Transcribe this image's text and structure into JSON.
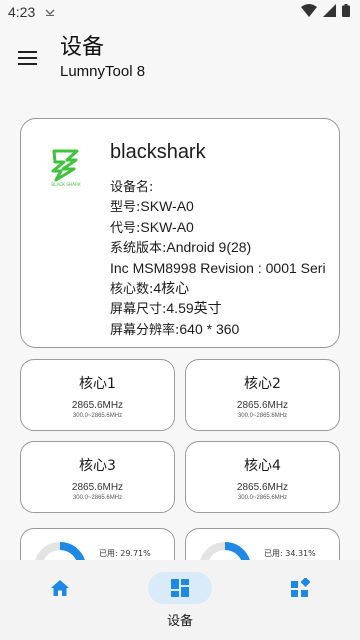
{
  "status": {
    "time": "4:23",
    "download_glyph": "⌄̲"
  },
  "app_bar": {
    "title": "设备",
    "subtitle": "LumnyTool 8"
  },
  "device": {
    "logo_text": "BLACK SHARK",
    "name": "blackshark",
    "info": [
      {
        "label": "设备名:",
        "value": ""
      },
      {
        "label": "型号:",
        "value": "SKW-A0"
      },
      {
        "label": "代号:",
        "value": "SKW-A0"
      },
      {
        "label": "系统版本:",
        "value": "Android 9(28)"
      },
      {
        "label": "",
        "value": " Inc MSM8998 Revision : 0001 Seri"
      },
      {
        "label": "核心数:",
        "value": "4核心"
      },
      {
        "label": "屏幕尺寸:",
        "value": "4.59英寸"
      },
      {
        "label": "屏幕分辨率:",
        "value": "640 * 360"
      }
    ]
  },
  "cores": [
    {
      "title": "核心1",
      "freq": "2865.6MHz",
      "range": "300.0~2865.6MHz"
    },
    {
      "title": "核心2",
      "freq": "2865.6MHz",
      "range": "300.0~2865.6MHz"
    },
    {
      "title": "核心3",
      "freq": "2865.6MHz",
      "range": "300.0~2865.6MHz"
    },
    {
      "title": "核心4",
      "freq": "2865.6MHz",
      "range": "300.0~2865.6MHz"
    }
  ],
  "memory": [
    {
      "used_label": "已用:  29.71%",
      "used_fraction": 0.2971
    },
    {
      "used_label": "已用:  34.31%",
      "used_fraction": 0.3431
    }
  ],
  "bottom_nav": {
    "items": [
      {
        "icon": "home-icon",
        "label": ""
      },
      {
        "icon": "dashboard-icon",
        "label": "设备"
      },
      {
        "icon": "widgets-icon",
        "label": ""
      }
    ],
    "active_index": 1
  },
  "colors": {
    "accent": "#1e88e5",
    "ring_track": "#e3e3e3",
    "nav_active": "#d9ebf8",
    "logo_green": "#3cc43c"
  }
}
